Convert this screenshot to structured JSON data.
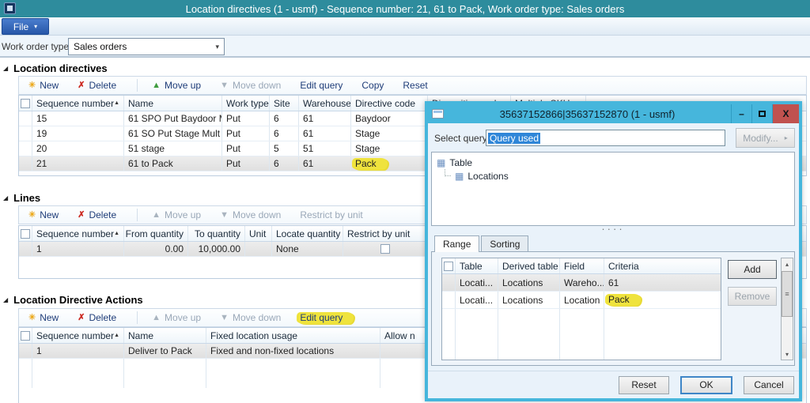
{
  "window": {
    "title": "Location directives (1 - usmf) - Sequence number: 21, 61 to Pack, Work order type: Sales orders",
    "menu": {
      "file_label": "File"
    },
    "filter": {
      "label": "Work order type:",
      "value": "Sales orders"
    }
  },
  "icons": {
    "new": "✳",
    "delete": "✗",
    "move_up": "▲",
    "move_down": "▼",
    "sort_asc": "▲",
    "dropdown": "▾",
    "caret": "▾",
    "modify_arrow": "▸",
    "minimize": "–",
    "close": "X",
    "tree_table": "▦",
    "splitter_dots": "····",
    "scroll_up": "▴",
    "scroll_down": "▾",
    "grip": "≡",
    "collapse": "◢"
  },
  "colors": {
    "titlebar_teal": "#2e8c9d",
    "file_blue": "#2757a8",
    "dialog_cyan": "#46b6dc",
    "close_red": "#c0524f",
    "highlight_yellow": "#efe33d",
    "selection_blue": "#2f86d8"
  },
  "sections": {
    "directives": {
      "title": "Location directives",
      "toolbar": {
        "new": "New",
        "delete": "Delete",
        "move_up": "Move up",
        "move_down": "Move down",
        "edit_query": "Edit query",
        "copy": "Copy",
        "reset": "Reset"
      },
      "columns": {
        "seq": "Sequence number",
        "name": "Name",
        "work_type": "Work type",
        "site": "Site",
        "warehouse": "Warehouse",
        "directive_code": "Directive code",
        "disposition_code": "Disposition code",
        "multiple_sku": "Multiple SKU"
      },
      "rows": [
        {
          "seq": "15",
          "name": "61 SPO Put Baydoor M...",
          "work_type": "Put",
          "site": "6",
          "warehouse": "61",
          "directive_code": "Baydoor"
        },
        {
          "seq": "19",
          "name": "61 SO Put Stage Mult",
          "work_type": "Put",
          "site": "6",
          "warehouse": "61",
          "directive_code": "Stage"
        },
        {
          "seq": "20",
          "name": "51 stage",
          "work_type": "Put",
          "site": "5",
          "warehouse": "51",
          "directive_code": "Stage"
        },
        {
          "seq": "21",
          "name": "61 to Pack",
          "work_type": "Put",
          "site": "6",
          "warehouse": "61",
          "directive_code": "Pack"
        }
      ]
    },
    "lines": {
      "title": "Lines",
      "toolbar": {
        "new": "New",
        "delete": "Delete",
        "move_up": "Move up",
        "move_down": "Move down",
        "restrict": "Restrict by unit"
      },
      "columns": {
        "seq": "Sequence number",
        "from_qty": "From quantity",
        "to_qty": "To quantity",
        "unit": "Unit",
        "locate_qty": "Locate quantity",
        "restrict": "Restrict by unit"
      },
      "rows": [
        {
          "seq": "1",
          "from_qty": "0.00",
          "to_qty": "10,000.00",
          "unit": "",
          "locate_qty": "None"
        }
      ]
    },
    "actions": {
      "title": "Location Directive Actions",
      "toolbar": {
        "new": "New",
        "delete": "Delete",
        "move_up": "Move up",
        "move_down": "Move down",
        "edit_query": "Edit query"
      },
      "columns": {
        "seq": "Sequence number",
        "name": "Name",
        "usage": "Fixed location usage",
        "allow": "Allow n"
      },
      "rows": [
        {
          "seq": "1",
          "name": "Deliver to Pack",
          "usage": "Fixed and non-fixed locations"
        }
      ]
    }
  },
  "dialog": {
    "title": "35637152866|35637152870 (1 - usmf)",
    "select_query": {
      "label": "Select query:",
      "value": "Query used"
    },
    "modify_label": "Modify...",
    "tree": {
      "root": "Table",
      "child": "Locations"
    },
    "tabs": {
      "range": "Range",
      "sorting": "Sorting"
    },
    "grid": {
      "columns": {
        "table": "Table",
        "derived": "Derived table",
        "field": "Field",
        "criteria": "Criteria"
      },
      "rows": [
        {
          "table": "Locati...",
          "derived": "Locations",
          "field": "Wareho...",
          "criteria": "61"
        },
        {
          "table": "Locati...",
          "derived": "Locations",
          "field": "Location",
          "criteria": "Pack"
        }
      ]
    },
    "buttons": {
      "add": "Add",
      "remove": "Remove",
      "reset": "Reset",
      "ok": "OK",
      "cancel": "Cancel"
    }
  }
}
